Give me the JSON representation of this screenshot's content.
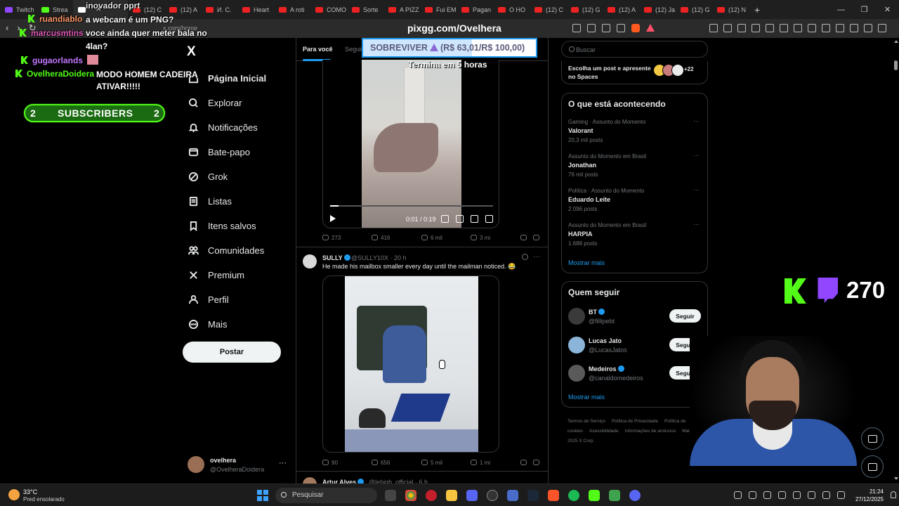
{
  "browser": {
    "tabs": [
      {
        "label": "Twitch",
        "type": "tw"
      },
      {
        "label": "Strea",
        "type": "kick"
      },
      {
        "label": "",
        "type": "x",
        "active": true
      },
      {
        "label": "(12) C",
        "type": "yt"
      },
      {
        "label": "(12) A",
        "type": "yt"
      },
      {
        "label": "И. С.",
        "type": "yt"
      },
      {
        "label": "Heart",
        "type": "yt"
      },
      {
        "label": "A roti",
        "type": "yt"
      },
      {
        "label": "COMO",
        "type": "yt"
      },
      {
        "label": "Sorte",
        "type": "yt"
      },
      {
        "label": "A PIZZ",
        "type": "yt"
      },
      {
        "label": "Fui EM",
        "type": "yt"
      },
      {
        "label": "Pagan",
        "type": "yt"
      },
      {
        "label": "O HO",
        "type": "yt"
      },
      {
        "label": "(12) C",
        "type": "yt"
      },
      {
        "label": "(12) G",
        "type": "yt"
      },
      {
        "label": "(12) A",
        "type": "yt"
      },
      {
        "label": "(12) Ja",
        "type": "yt"
      },
      {
        "label": "(12) G",
        "type": "yt"
      },
      {
        "label": "(12) N",
        "type": "yt"
      }
    ],
    "new_tab": "+",
    "url_small": "x.com/home",
    "page_title": "pixgg.com/Ovelhera"
  },
  "x_nav": {
    "logo": "X",
    "items": [
      {
        "label": "Página Inicial",
        "icon": "home-icon",
        "active": true
      },
      {
        "label": "Explorar",
        "icon": "search-icon"
      },
      {
        "label": "Notificações",
        "icon": "bell-icon"
      },
      {
        "label": "Bate-papo",
        "icon": "chat-icon"
      },
      {
        "label": "Grok",
        "icon": "grok-icon"
      },
      {
        "label": "Listas",
        "icon": "list-icon"
      },
      {
        "label": "Itens salvos",
        "icon": "bookmark-icon"
      },
      {
        "label": "Comunidades",
        "icon": "people-icon"
      },
      {
        "label": "Premium",
        "icon": "x-icon"
      },
      {
        "label": "Perfil",
        "icon": "person-icon"
      },
      {
        "label": "Mais",
        "icon": "more-icon"
      }
    ],
    "post_label": "Postar",
    "account": {
      "name": "ovelhera",
      "handle": "@OvelheraDoidera",
      "more": "···"
    }
  },
  "feed": {
    "tabs": [
      "Para você",
      "Seguindo"
    ],
    "video1": {
      "time": "0:01 / 0:19",
      "progress": 0.05
    },
    "actions1": {
      "replies": "273",
      "reposts": "416",
      "likes": "6 mil",
      "views": "3 mi"
    },
    "tweet2": {
      "name": "SULLY",
      "handle": "@SULLY10X",
      "time": "20 h",
      "dot": "·",
      "more": "···",
      "text": "He made his mailbox smaller every day until the mailman noticed. 😂"
    },
    "actions2": {
      "replies": "90",
      "reposts": "656",
      "likes": "5 mil",
      "views": "1 mi"
    },
    "tweet3": {
      "name": "Artur Alves",
      "handle": "@lebigh_official",
      "time": "6 h"
    }
  },
  "sidebar": {
    "search_placeholder": "Buscar",
    "spaces": {
      "text": "Escolha um post e apresente no Spaces",
      "count": "+22"
    },
    "trends_title": "O que está acontecendo",
    "trends": [
      {
        "context": "Gaming · Assunto do Momento",
        "name": "Valorant",
        "posts": "20,3 mil posts"
      },
      {
        "context": "Assunto do Momento em Brasil",
        "name": "Jonathan",
        "posts": "76 mil posts"
      },
      {
        "context": "Política · Assunto do Momento",
        "name": "Eduardo Leite",
        "posts": "2.096 posts"
      },
      {
        "context": "Assunto do Momento em Brasil",
        "name": "HARPIA",
        "posts": "1.688 posts"
      }
    ],
    "trend_more": "···",
    "show_more": "Mostrar mais",
    "follow_title": "Quem seguir",
    "follow": [
      {
        "name": "BT",
        "handle": "@fillipebt",
        "verified": true,
        "color": "#3a3a3a"
      },
      {
        "name": "Lucas Jato",
        "handle": "@LucasJatos",
        "verified": false,
        "color": "#8ab4d8"
      },
      {
        "name": "Medeiros",
        "handle": "@canaldomedeiros",
        "verified": true,
        "color": "#5a5a5a"
      }
    ],
    "follow_btn": "Seguir",
    "footer": [
      "Termos de Serviço",
      "Política de Privacidade",
      "Política de cookies",
      "Acessibilidade",
      "Informações de anúncios",
      "Mais ···",
      "© 2025 X Corp."
    ]
  },
  "overlay": {
    "chat": [
      {
        "user": "inovador pprt",
        "user_color": "#ffffff",
        "msg": ""
      },
      {
        "user": "ruandiablo",
        "user_color": "#ff9a6b",
        "msg": "a webcam é um PNG?"
      },
      {
        "user": "marcusmtins",
        "user_color": "#e05ab8",
        "msg": "voce ainda quer meter bala no"
      },
      {
        "user": "",
        "user_color": "",
        "msg": "4lan?"
      },
      {
        "user": "gugaorlands",
        "user_color": "#c276ff",
        "msg": ""
      },
      {
        "user": "OvelheraDoidera",
        "user_color": "#53fc18",
        "msg": "MODO HOMEM CADEIRA"
      },
      {
        "user": "",
        "user_color": "",
        "msg": "ATIVAR!!!!!"
      }
    ],
    "subs": {
      "left": "2",
      "label": "SUBSCRIBERS",
      "right": "2"
    },
    "goal": {
      "label_a": "SOBREVIVER",
      "label_b": "(R$ 63,01/R$ 100,00)",
      "progress": 0.6301,
      "sub": "Termina em 5 horas"
    },
    "viewers": "270"
  },
  "taskbar": {
    "temp": "33°C",
    "weather": "Pred ensolarado",
    "search": "Pesquisar",
    "time": "21:24",
    "date": "27/12/2025"
  }
}
